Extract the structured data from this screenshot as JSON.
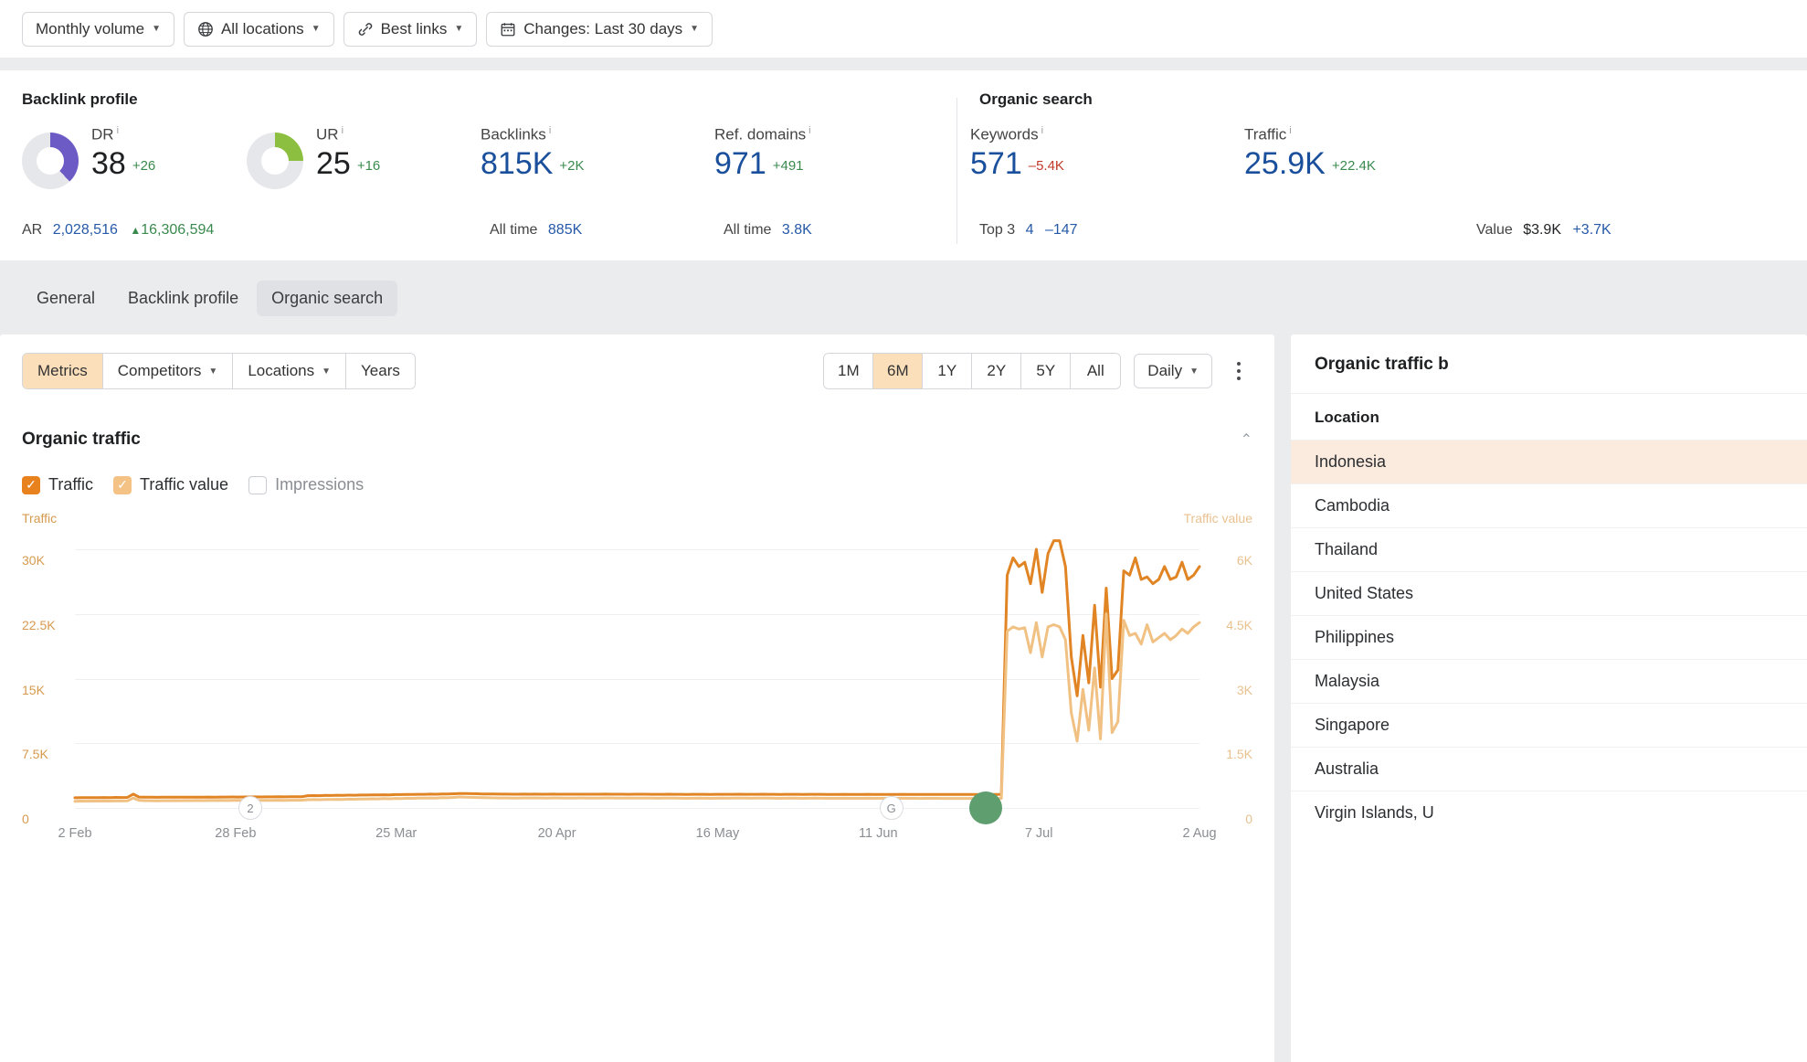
{
  "toolbar": {
    "filters": [
      {
        "label": "Monthly volume",
        "icon": "none",
        "caret": true
      },
      {
        "label": "All locations",
        "icon": "globe-icon",
        "caret": true
      },
      {
        "label": "Best links",
        "icon": "link-icon",
        "caret": true
      },
      {
        "label": "Changes: Last 30 days",
        "icon": "calendar-icon",
        "caret": true
      }
    ]
  },
  "overview": {
    "backlink_title": "Backlink profile",
    "organic_title": "Organic search",
    "dr": {
      "label": "DR",
      "value": "38",
      "delta": "+26",
      "delta_sign": "pos",
      "pct": 38,
      "color": "#6c5bc4"
    },
    "ur": {
      "label": "UR",
      "value": "25",
      "delta": "+16",
      "delta_sign": "pos",
      "pct": 25,
      "color": "#8cbf3f"
    },
    "backlinks": {
      "label": "Backlinks",
      "value": "815K",
      "delta": "+2K",
      "delta_sign": "pos",
      "sub_key": "All time",
      "sub_value": "885K"
    },
    "refdomains": {
      "label": "Ref. domains",
      "value": "971",
      "delta": "+491",
      "delta_sign": "pos",
      "sub_key": "All time",
      "sub_value": "3.8K"
    },
    "keywords": {
      "label": "Keywords",
      "value": "571",
      "delta": "–5.4K",
      "delta_sign": "neg",
      "sub_key": "Top 3",
      "sub_value": "4",
      "sub_delta": "–147",
      "sub_delta_sign": "neg"
    },
    "traffic": {
      "label": "Traffic",
      "value": "25.9K",
      "delta": "+22.4K",
      "delta_sign": "pos",
      "sub_key": "Value",
      "sub_value": "$3.9K",
      "sub_delta": "+3.7K",
      "sub_delta_sign": "pos"
    },
    "ar": {
      "label": "AR",
      "value": "2,028,516",
      "delta": "16,306,594",
      "arrow": "▲"
    }
  },
  "tabs": {
    "items": [
      {
        "label": "General",
        "active": false
      },
      {
        "label": "Backlink profile",
        "active": false
      },
      {
        "label": "Organic search",
        "active": true
      }
    ]
  },
  "chart_panel": {
    "segments": [
      {
        "label": "Metrics",
        "caret": false,
        "selected": true
      },
      {
        "label": "Competitors",
        "caret": true,
        "selected": false
      },
      {
        "label": "Locations",
        "caret": true,
        "selected": false
      },
      {
        "label": "Years",
        "caret": false,
        "selected": false
      }
    ],
    "ranges": [
      {
        "label": "1M",
        "selected": false
      },
      {
        "label": "6M",
        "selected": true
      },
      {
        "label": "1Y",
        "selected": false
      },
      {
        "label": "2Y",
        "selected": false
      },
      {
        "label": "5Y",
        "selected": false
      },
      {
        "label": "All",
        "selected": false
      }
    ],
    "granularity": "Daily",
    "heading": "Organic traffic",
    "legend": [
      {
        "label": "Traffic",
        "state": "on"
      },
      {
        "label": "Traffic value",
        "state": "on2"
      },
      {
        "label": "Impressions",
        "state": "off"
      }
    ]
  },
  "sidebar": {
    "title": "Organic traffic b",
    "column_header": "Location",
    "rows": [
      {
        "name": "Indonesia",
        "highlighted": true
      },
      {
        "name": "Cambodia",
        "highlighted": false
      },
      {
        "name": "Thailand",
        "highlighted": false
      },
      {
        "name": "United States",
        "highlighted": false
      },
      {
        "name": "Philippines",
        "highlighted": false
      },
      {
        "name": "Malaysia",
        "highlighted": false
      },
      {
        "name": "Singapore",
        "highlighted": false
      },
      {
        "name": "Australia",
        "highlighted": false
      },
      {
        "name": "Virgin Islands, U",
        "highlighted": false
      }
    ]
  },
  "chart_data": {
    "type": "line",
    "title": "Organic traffic",
    "xlabel": "",
    "ylabel": "Traffic",
    "y2label": "Traffic value",
    "ylim": [
      0,
      30000
    ],
    "y2lim": [
      0,
      6000
    ],
    "yticks": [
      "0",
      "7.5K",
      "15K",
      "22.5K",
      "30K"
    ],
    "y2ticks": [
      "0",
      "1.5K",
      "3K",
      "4.5K",
      "6K"
    ],
    "xticks": [
      "2 Feb",
      "28 Feb",
      "25 Mar",
      "20 Apr",
      "16 May",
      "11 Jun",
      "7 Jul",
      "2 Aug"
    ],
    "grid": true,
    "legend_position": "top-left",
    "annotations": [
      {
        "label": "2",
        "x_pct": 15.6,
        "note": "axis-marker"
      },
      {
        "label": "G",
        "x_pct": 72.6,
        "note": "axis-marker"
      },
      {
        "label": "",
        "x_pct": 81.0,
        "note": "green-event-dot"
      }
    ],
    "series": [
      {
        "name": "Traffic",
        "color": "#e08424",
        "axis": "left",
        "values": [
          1180,
          1190,
          1185,
          1200,
          1190,
          1210,
          1200,
          1215,
          1205,
          1220,
          1600,
          1260,
          1240,
          1235,
          1230,
          1240,
          1235,
          1245,
          1240,
          1250,
          1245,
          1255,
          1250,
          1260,
          1255,
          1265,
          1260,
          1270,
          1265,
          1275,
          1270,
          1280,
          1275,
          1285,
          1280,
          1290,
          1285,
          1295,
          1290,
          1300,
          1420,
          1430,
          1425,
          1450,
          1440,
          1470,
          1460,
          1480,
          1470,
          1490,
          1500,
          1510,
          1505,
          1530,
          1520,
          1550,
          1545,
          1570,
          1560,
          1580,
          1575,
          1600,
          1590,
          1620,
          1610,
          1640,
          1680,
          1660,
          1650,
          1640,
          1620,
          1615,
          1610,
          1605,
          1600,
          1595,
          1590,
          1600,
          1595,
          1600,
          1595,
          1590,
          1600,
          1595,
          1590,
          1585,
          1590,
          1595,
          1590,
          1585,
          1590,
          1600,
          1595,
          1590,
          1585,
          1580,
          1585,
          1590,
          1585,
          1580,
          1575,
          1580,
          1585,
          1580,
          1575,
          1570,
          1575,
          1580,
          1575,
          1570,
          1575,
          1580,
          1575,
          1580,
          1585,
          1580,
          1575,
          1580,
          1585,
          1580,
          1575,
          1570,
          1575,
          1580,
          1575,
          1570,
          1575,
          1580,
          1575,
          1570,
          1565,
          1570,
          1575,
          1570,
          1565,
          1570,
          1575,
          1570,
          1565,
          1570,
          1565,
          1570,
          1575,
          1570,
          1565,
          1560,
          1565,
          1570,
          1565,
          1560,
          1560,
          1560,
          1560,
          1560,
          1560,
          1560,
          1560,
          1560,
          1560,
          1560,
          27000,
          29000,
          28000,
          28500,
          26000,
          30000,
          25000,
          29500,
          31000,
          31000,
          28000,
          17500,
          13000,
          20000,
          14500,
          23500,
          14000,
          25500,
          15000,
          16000,
          27500,
          27000,
          29000,
          26500,
          26800,
          26000,
          26500,
          28000,
          26500,
          26800,
          28500,
          26500,
          27000,
          28000
        ]
      },
      {
        "name": "Traffic value",
        "color": "#f0c183",
        "axis": "right",
        "values": [
          155,
          158,
          156,
          160,
          158,
          162,
          160,
          163,
          161,
          164,
          230,
          175,
          170,
          168,
          166,
          168,
          167,
          169,
          168,
          170,
          169,
          171,
          170,
          172,
          171,
          173,
          172,
          174,
          173,
          175,
          174,
          176,
          175,
          177,
          176,
          178,
          177,
          179,
          178,
          180,
          190,
          192,
          191,
          196,
          194,
          200,
          198,
          203,
          201,
          206,
          208,
          211,
          210,
          216,
          213,
          220,
          218,
          225,
          222,
          228,
          226,
          232,
          230,
          238,
          235,
          243,
          255,
          248,
          245,
          242,
          238,
          236,
          234,
          232,
          231,
          230,
          229,
          232,
          231,
          232,
          231,
          229,
          232,
          231,
          229,
          228,
          229,
          231,
          229,
          228,
          229,
          232,
          231,
          229,
          228,
          226,
          228,
          229,
          228,
          226,
          225,
          226,
          228,
          226,
          225,
          223,
          225,
          226,
          225,
          223,
          225,
          226,
          225,
          226,
          228,
          226,
          225,
          226,
          228,
          226,
          225,
          223,
          225,
          226,
          225,
          223,
          225,
          226,
          225,
          223,
          222,
          223,
          225,
          223,
          222,
          223,
          225,
          223,
          222,
          223,
          222,
          223,
          225,
          223,
          222,
          220,
          222,
          223,
          222,
          220,
          220,
          220,
          220,
          220,
          220,
          220,
          220,
          220,
          220,
          220,
          4100,
          4200,
          4150,
          4180,
          3600,
          4300,
          3500,
          4200,
          4250,
          4200,
          3900,
          2200,
          1550,
          2750,
          1800,
          3250,
          1600,
          4500,
          1750,
          2000,
          4350,
          4000,
          4050,
          3800,
          4250,
          3850,
          3950,
          4050,
          3900,
          4000,
          4150,
          4050,
          4200,
          4300
        ]
      }
    ]
  }
}
